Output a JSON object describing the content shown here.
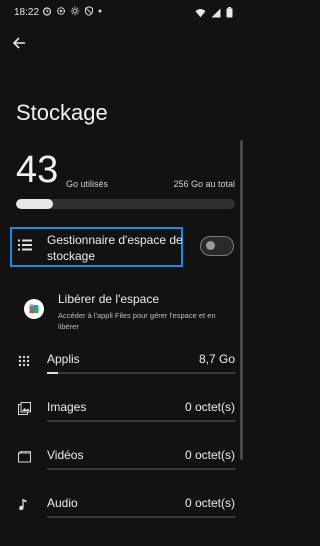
{
  "status_bar": {
    "time": "18:22"
  },
  "page": {
    "title": "Stockage",
    "used_value": "43",
    "used_label": "Go utilisés",
    "total_label": "256 Go au total",
    "usage_fraction": 0.17
  },
  "storage_manager": {
    "label": "Gestionnaire d'espace de stockage",
    "enabled": false
  },
  "free_up": {
    "title": "Libérer de l'espace",
    "description": "Accéder à l'appli Files pour gérer l'espace et en libérer"
  },
  "categories": [
    {
      "label": "Applis",
      "value": "8,7 Go",
      "fraction": 0.06,
      "icon": "apps-grid-icon"
    },
    {
      "label": "Images",
      "value": "0 octet(s)",
      "fraction": 0,
      "icon": "image-icon"
    },
    {
      "label": "Vidéos",
      "value": "0 octet(s)",
      "fraction": 0,
      "icon": "video-icon"
    },
    {
      "label": "Audio",
      "value": "0 octet(s)",
      "fraction": 0,
      "icon": "music-note-icon"
    }
  ],
  "colors": {
    "background": "#121212",
    "highlight": "#1e88e5"
  }
}
